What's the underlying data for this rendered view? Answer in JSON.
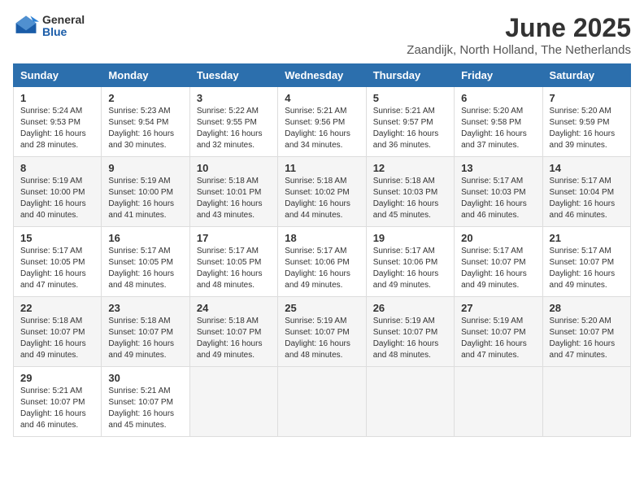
{
  "header": {
    "logo_general": "General",
    "logo_blue": "Blue",
    "month_title": "June 2025",
    "location": "Zaandijk, North Holland, The Netherlands"
  },
  "weekdays": [
    "Sunday",
    "Monday",
    "Tuesday",
    "Wednesday",
    "Thursday",
    "Friday",
    "Saturday"
  ],
  "weeks": [
    [
      {
        "day": 1,
        "sunrise": "5:24 AM",
        "sunset": "9:53 PM",
        "daylight": "16 hours and 28 minutes."
      },
      {
        "day": 2,
        "sunrise": "5:23 AM",
        "sunset": "9:54 PM",
        "daylight": "16 hours and 30 minutes."
      },
      {
        "day": 3,
        "sunrise": "5:22 AM",
        "sunset": "9:55 PM",
        "daylight": "16 hours and 32 minutes."
      },
      {
        "day": 4,
        "sunrise": "5:21 AM",
        "sunset": "9:56 PM",
        "daylight": "16 hours and 34 minutes."
      },
      {
        "day": 5,
        "sunrise": "5:21 AM",
        "sunset": "9:57 PM",
        "daylight": "16 hours and 36 minutes."
      },
      {
        "day": 6,
        "sunrise": "5:20 AM",
        "sunset": "9:58 PM",
        "daylight": "16 hours and 37 minutes."
      },
      {
        "day": 7,
        "sunrise": "5:20 AM",
        "sunset": "9:59 PM",
        "daylight": "16 hours and 39 minutes."
      }
    ],
    [
      {
        "day": 8,
        "sunrise": "5:19 AM",
        "sunset": "10:00 PM",
        "daylight": "16 hours and 40 minutes."
      },
      {
        "day": 9,
        "sunrise": "5:19 AM",
        "sunset": "10:00 PM",
        "daylight": "16 hours and 41 minutes."
      },
      {
        "day": 10,
        "sunrise": "5:18 AM",
        "sunset": "10:01 PM",
        "daylight": "16 hours and 43 minutes."
      },
      {
        "day": 11,
        "sunrise": "5:18 AM",
        "sunset": "10:02 PM",
        "daylight": "16 hours and 44 minutes."
      },
      {
        "day": 12,
        "sunrise": "5:18 AM",
        "sunset": "10:03 PM",
        "daylight": "16 hours and 45 minutes."
      },
      {
        "day": 13,
        "sunrise": "5:17 AM",
        "sunset": "10:03 PM",
        "daylight": "16 hours and 46 minutes."
      },
      {
        "day": 14,
        "sunrise": "5:17 AM",
        "sunset": "10:04 PM",
        "daylight": "16 hours and 46 minutes."
      }
    ],
    [
      {
        "day": 15,
        "sunrise": "5:17 AM",
        "sunset": "10:05 PM",
        "daylight": "16 hours and 47 minutes."
      },
      {
        "day": 16,
        "sunrise": "5:17 AM",
        "sunset": "10:05 PM",
        "daylight": "16 hours and 48 minutes."
      },
      {
        "day": 17,
        "sunrise": "5:17 AM",
        "sunset": "10:05 PM",
        "daylight": "16 hours and 48 minutes."
      },
      {
        "day": 18,
        "sunrise": "5:17 AM",
        "sunset": "10:06 PM",
        "daylight": "16 hours and 49 minutes."
      },
      {
        "day": 19,
        "sunrise": "5:17 AM",
        "sunset": "10:06 PM",
        "daylight": "16 hours and 49 minutes."
      },
      {
        "day": 20,
        "sunrise": "5:17 AM",
        "sunset": "10:07 PM",
        "daylight": "16 hours and 49 minutes."
      },
      {
        "day": 21,
        "sunrise": "5:17 AM",
        "sunset": "10:07 PM",
        "daylight": "16 hours and 49 minutes."
      }
    ],
    [
      {
        "day": 22,
        "sunrise": "5:18 AM",
        "sunset": "10:07 PM",
        "daylight": "16 hours and 49 minutes."
      },
      {
        "day": 23,
        "sunrise": "5:18 AM",
        "sunset": "10:07 PM",
        "daylight": "16 hours and 49 minutes."
      },
      {
        "day": 24,
        "sunrise": "5:18 AM",
        "sunset": "10:07 PM",
        "daylight": "16 hours and 49 minutes."
      },
      {
        "day": 25,
        "sunrise": "5:19 AM",
        "sunset": "10:07 PM",
        "daylight": "16 hours and 48 minutes."
      },
      {
        "day": 26,
        "sunrise": "5:19 AM",
        "sunset": "10:07 PM",
        "daylight": "16 hours and 48 minutes."
      },
      {
        "day": 27,
        "sunrise": "5:19 AM",
        "sunset": "10:07 PM",
        "daylight": "16 hours and 47 minutes."
      },
      {
        "day": 28,
        "sunrise": "5:20 AM",
        "sunset": "10:07 PM",
        "daylight": "16 hours and 47 minutes."
      }
    ],
    [
      {
        "day": 29,
        "sunrise": "5:21 AM",
        "sunset": "10:07 PM",
        "daylight": "16 hours and 46 minutes."
      },
      {
        "day": 30,
        "sunrise": "5:21 AM",
        "sunset": "10:07 PM",
        "daylight": "16 hours and 45 minutes."
      },
      null,
      null,
      null,
      null,
      null
    ]
  ]
}
